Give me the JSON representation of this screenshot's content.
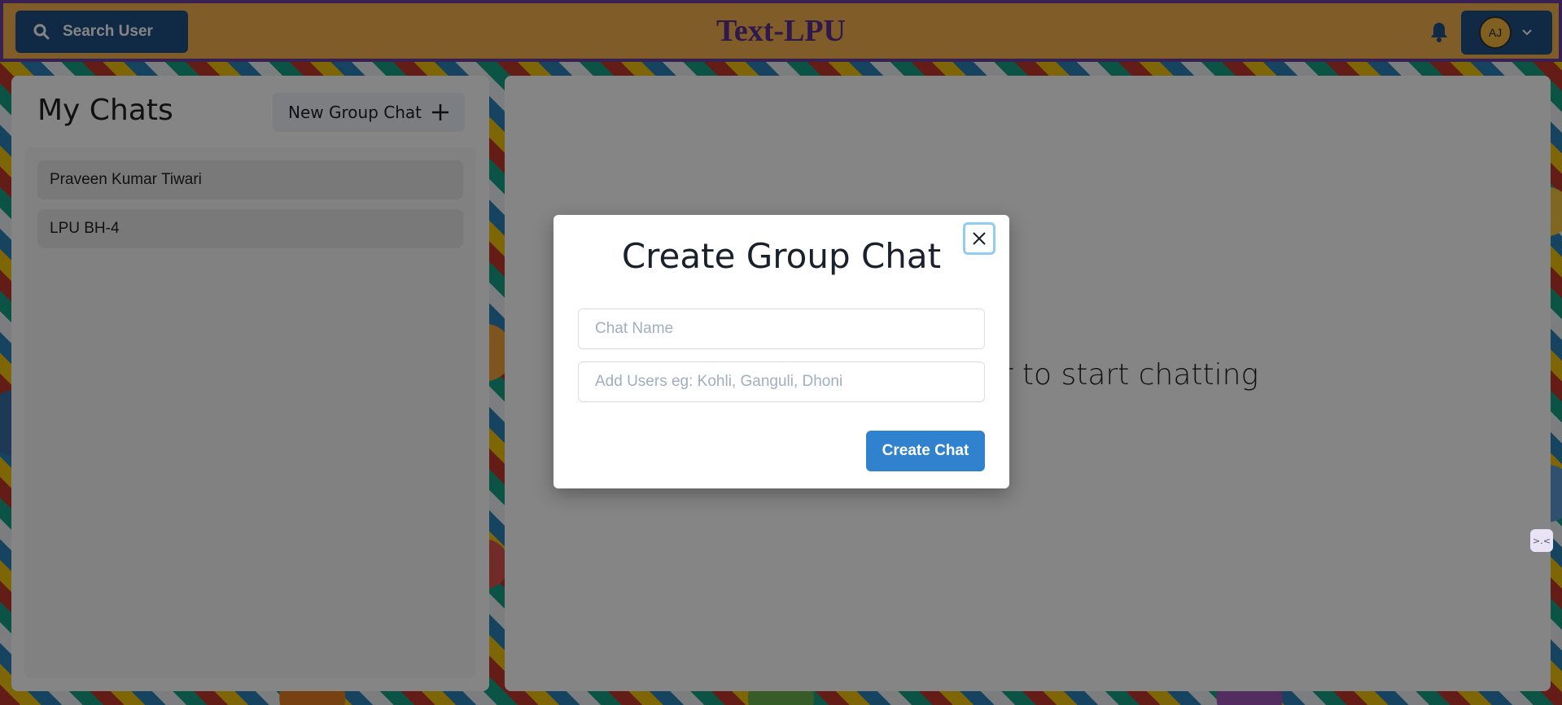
{
  "header": {
    "search_label": "Search User",
    "app_title": "Text-LPU",
    "avatar_initials": "AJ",
    "colors": {
      "bar": "#f6b34e",
      "border": "#6b3fa0",
      "title": "#5a2e91",
      "button": "#1f4f85"
    }
  },
  "sidebar": {
    "title": "My Chats",
    "new_group_label": "New Group Chat",
    "chats": [
      {
        "name": "Praveen Kumar Tiwari"
      },
      {
        "name": "LPU BH-4"
      }
    ]
  },
  "main": {
    "placeholder_message": "Click on a user to start chatting"
  },
  "modal": {
    "title": "Create Group Chat",
    "chat_name_placeholder": "Chat Name",
    "add_users_placeholder": "Add Users eg: Kohli, Ganguli, Dhoni",
    "submit_label": "Create Chat",
    "accent": "#3182ce"
  },
  "icons": [
    "search-icon",
    "bell-icon",
    "chevron-down-icon",
    "plus-icon",
    "close-icon"
  ]
}
